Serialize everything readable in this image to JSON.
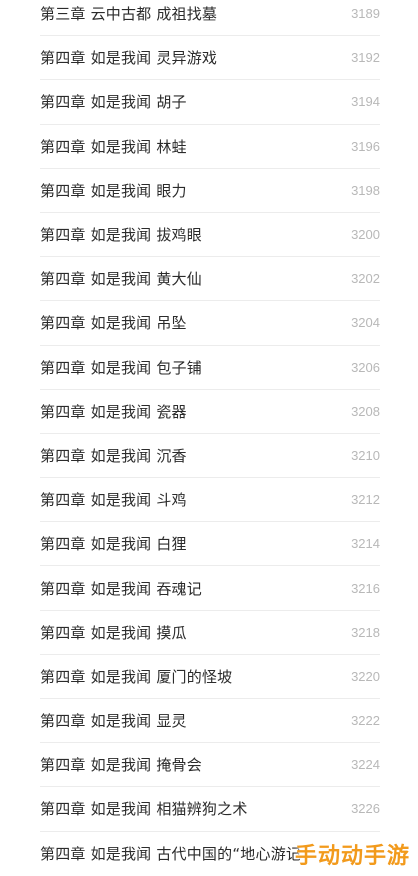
{
  "toc": [
    {
      "title": "第三章 云中古都 成祖找墓",
      "page": "3189"
    },
    {
      "title": "第四章 如是我闻 灵异游戏",
      "page": "3192"
    },
    {
      "title": "第四章 如是我闻 胡子",
      "page": "3194"
    },
    {
      "title": "第四章 如是我闻 林蛙",
      "page": "3196"
    },
    {
      "title": "第四章 如是我闻 眼力",
      "page": "3198"
    },
    {
      "title": "第四章 如是我闻 拔鸡眼",
      "page": "3200"
    },
    {
      "title": "第四章 如是我闻 黄大仙",
      "page": "3202"
    },
    {
      "title": "第四章 如是我闻 吊坠",
      "page": "3204"
    },
    {
      "title": "第四章 如是我闻 包子铺",
      "page": "3206"
    },
    {
      "title": "第四章 如是我闻 瓷器",
      "page": "3208"
    },
    {
      "title": "第四章 如是我闻 沉香",
      "page": "3210"
    },
    {
      "title": "第四章 如是我闻 斗鸡",
      "page": "3212"
    },
    {
      "title": "第四章 如是我闻 白狸",
      "page": "3214"
    },
    {
      "title": "第四章 如是我闻 吞魂记",
      "page": "3216"
    },
    {
      "title": "第四章 如是我闻 摸瓜",
      "page": "3218"
    },
    {
      "title": "第四章 如是我闻 厦门的怪坡",
      "page": "3220"
    },
    {
      "title": "第四章 如是我闻 显灵",
      "page": "3222"
    },
    {
      "title": "第四章 如是我闻 掩骨会",
      "page": "3224"
    },
    {
      "title": "第四章 如是我闻 相猫辨狗之术",
      "page": "3226"
    },
    {
      "title": "第四章 如是我闻 古代中国的“地心游记",
      "page": ""
    }
  ],
  "watermark": "手动动手游",
  "colors": {
    "title_text": "#2b2b2b",
    "page_number": "#b8b8b8",
    "divider": "#ececec",
    "watermark": "#f29a1c"
  }
}
